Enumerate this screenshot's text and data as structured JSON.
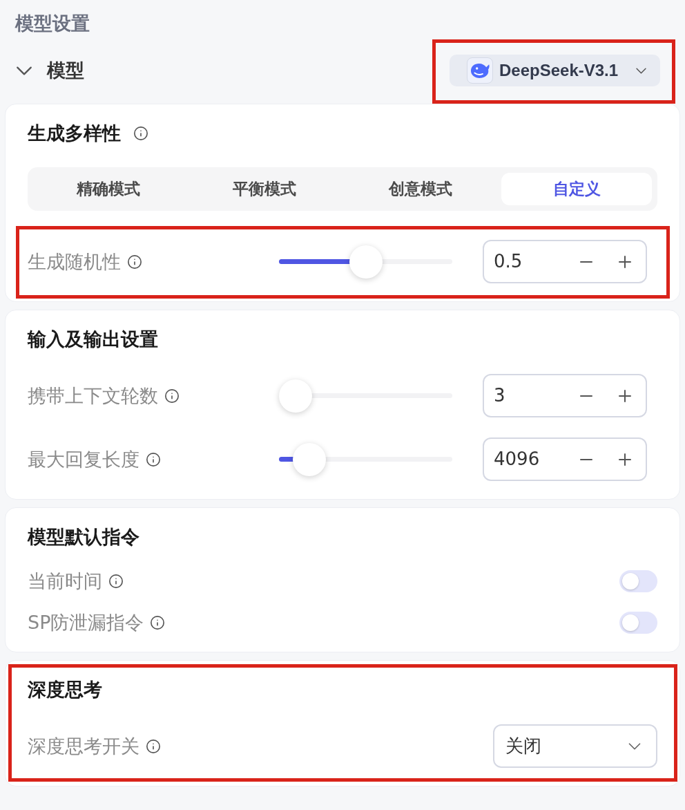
{
  "header": {
    "title": "模型设置"
  },
  "model_row": {
    "label": "模型",
    "expanded": true,
    "selector": {
      "value": "DeepSeek-V3.1",
      "highlighted": true
    }
  },
  "sections": [
    {
      "title": "生成多样性",
      "info": true,
      "highlighted": false,
      "modes": [
        {
          "label": "精确模式",
          "selected": false
        },
        {
          "label": "平衡模式",
          "selected": false
        },
        {
          "label": "创意模式",
          "selected": false
        },
        {
          "label": "自定义",
          "selected": true
        }
      ],
      "rows": [
        {
          "kind": "slider",
          "label": "生成随机性",
          "info": true,
          "highlighted": true,
          "level": 0.5,
          "value": "0.5"
        }
      ]
    },
    {
      "title": "输入及输出设置",
      "info": false,
      "highlighted": false,
      "rows": [
        {
          "kind": "slider",
          "label": "携带上下文轮数",
          "info": true,
          "highlighted": false,
          "level": 0,
          "value": "3"
        },
        {
          "kind": "slider",
          "label": "最大回复长度",
          "info": true,
          "highlighted": false,
          "level": 0.1,
          "value": "4096"
        }
      ]
    },
    {
      "title": "模型默认指令",
      "info": false,
      "highlighted": false,
      "rows": [
        {
          "kind": "switch",
          "label": "当前时间",
          "info": true,
          "highlighted": false,
          "on": false
        },
        {
          "kind": "switch",
          "label": "SP防泄漏指令",
          "info": true,
          "highlighted": false,
          "on": false
        }
      ]
    },
    {
      "title": "深度思考",
      "info": false,
      "highlighted": true,
      "rows": [
        {
          "kind": "select",
          "label": "深度思考开关",
          "info": true,
          "highlighted": false,
          "value": "关闭"
        }
      ]
    }
  ]
}
